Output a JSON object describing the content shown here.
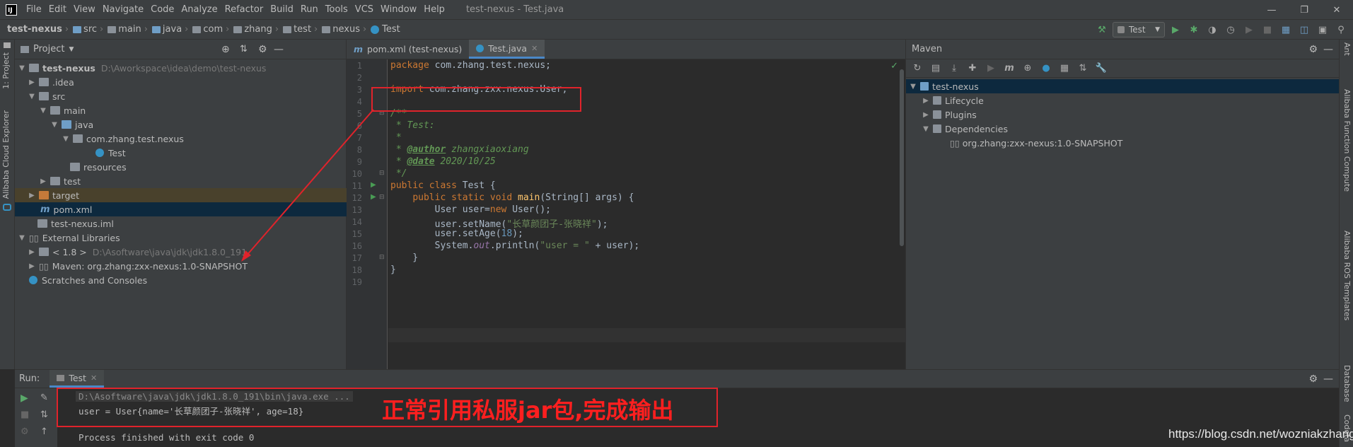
{
  "window": {
    "title": "test-nexus - Test.java",
    "logo": "IJ",
    "menu": [
      "File",
      "Edit",
      "View",
      "Navigate",
      "Code",
      "Analyze",
      "Refactor",
      "Build",
      "Run",
      "Tools",
      "VCS",
      "Window",
      "Help"
    ]
  },
  "breadcrumb": [
    "test-nexus",
    "src",
    "main",
    "java",
    "com",
    "zhang",
    "test",
    "nexus",
    "Test"
  ],
  "run_config": "Test",
  "left_strip": {
    "project_tab": "1: Project",
    "cloud_tab": "Alibaba Cloud Explorer"
  },
  "project": {
    "title": "Project",
    "tree": [
      {
        "label": "test-nexus",
        "path": "D:\\Aworkspace\\idea\\demo\\test-nexus",
        "bold": true
      },
      {
        "label": ".idea"
      },
      {
        "label": "src"
      },
      {
        "label": "main"
      },
      {
        "label": "java"
      },
      {
        "label": "com.zhang.test.nexus"
      },
      {
        "label": "Test"
      },
      {
        "label": "resources"
      },
      {
        "label": "test"
      },
      {
        "label": "target"
      },
      {
        "label": "pom.xml"
      },
      {
        "label": "test-nexus.iml"
      },
      {
        "label": "External Libraries"
      },
      {
        "label": "< 1.8 >",
        "path": "D:\\Asoftware\\java\\jdk\\jdk1.8.0_191"
      },
      {
        "label": "Maven: org.zhang:zxx-nexus:1.0-SNAPSHOT"
      },
      {
        "label": "Scratches and Consoles"
      }
    ]
  },
  "editor": {
    "tabs": [
      "pom.xml (test-nexus)",
      "Test.java"
    ],
    "line_numbers": [
      "1",
      "2",
      "3",
      "4",
      "5",
      "6",
      "7",
      "8",
      "9",
      "10",
      "11",
      "12",
      "13",
      "14",
      "15",
      "16",
      "17",
      "18",
      "19"
    ],
    "code": {
      "l1_kw": "package ",
      "l1_rest": "com.zhang.test.nexus;",
      "l3_kw": "import ",
      "l3_rest": "com.zhang.zxx.nexus.User;",
      "l5": "/**",
      "l6": " * Test:",
      "l7": " *",
      "l8_pre": " * ",
      "l8_tag": "@author",
      "l8_val": " zhangxiaoxiang",
      "l9_pre": " * ",
      "l9_tag": "@date",
      "l9_val": " 2020/10/25",
      "l10": " */",
      "l11_kw": "public class ",
      "l11_rest": "Test {",
      "l12_indent": "    ",
      "l12_kw": "public static void ",
      "l12_fn": "main",
      "l12_rest": "(String[] args) {",
      "l13_a": "        User user=",
      "l13_kw": "new ",
      "l13_b": "User();",
      "l14_a": "        user.setName(",
      "l14_str": "\"长草颜团子-张晓祥\"",
      "l14_b": ");",
      "l15_a": "        user.setAge(",
      "l15_num": "18",
      "l15_b": ");",
      "l16_a": "        System.",
      "l16_stat": "out",
      "l16_b": ".println(",
      "l16_str": "\"user = \"",
      "l16_c": " + user);",
      "l17": "    }",
      "l18": "}"
    }
  },
  "maven": {
    "title": "Maven",
    "tree": [
      {
        "label": "test-nexus"
      },
      {
        "label": "Lifecycle"
      },
      {
        "label": "Plugins"
      },
      {
        "label": "Dependencies"
      },
      {
        "label": "org.zhang:zxx-nexus:1.0-SNAPSHOT"
      }
    ]
  },
  "right_strip": [
    "Ant",
    "Alibaba Function Compute",
    "Alibaba ROS Templates",
    "Database",
    "Codota"
  ],
  "run": {
    "label": "Run:",
    "tab": "Test",
    "console": [
      "D:\\Asoftware\\java\\jdk\\jdk1.8.0_191\\bin\\java.exe ...",
      "user = User{name='长草颜团子-张晓祥', age=18}",
      "",
      "Process finished with exit code 0"
    ]
  },
  "annotation": "正常引用私服jar包,完成输出",
  "watermark": "https://blog.csdn.net/wozniakzhang",
  "colors": {
    "accent": "#4a88c7",
    "annotation": "#e0232b",
    "selection": "#0d293e"
  }
}
